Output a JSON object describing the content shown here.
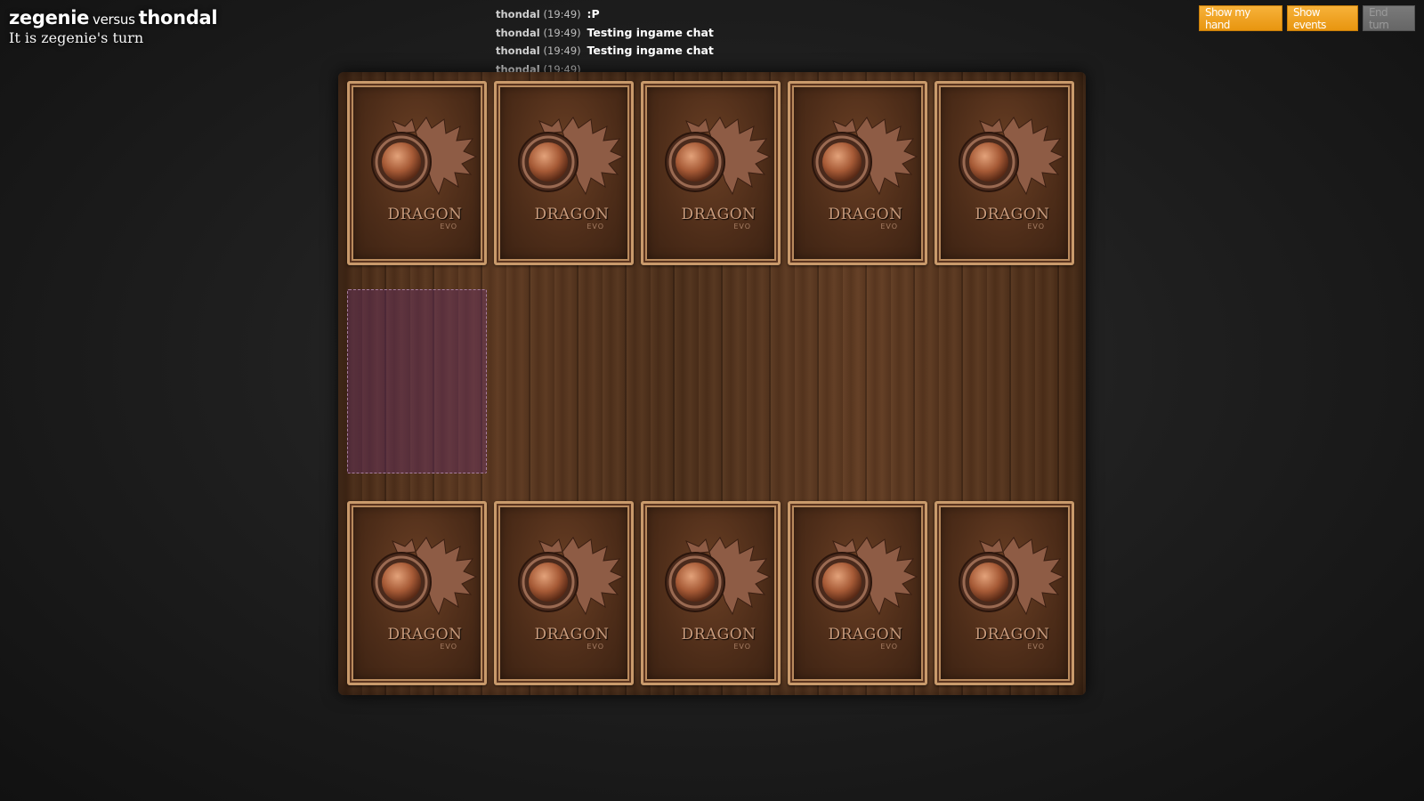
{
  "header": {
    "player1": "zegenie",
    "versus": "versus",
    "player2": "thondal",
    "turn_text": "It is zegenie's turn"
  },
  "chat": [
    {
      "user": "thondal",
      "time": "(19:49)",
      "message": ":P"
    },
    {
      "user": "thondal",
      "time": "(19:49)",
      "message": "Testing ingame chat"
    },
    {
      "user": "thondal",
      "time": "(19:49)",
      "message": "Testing ingame chat"
    },
    {
      "user": "thondal",
      "time": "(19:49)",
      "message": ""
    }
  ],
  "actions": {
    "show_hand": "Show my hand",
    "show_events": "Show events",
    "end_turn": "End turn"
  },
  "card_back": {
    "logo": "DRAGON",
    "sub": "EVO"
  },
  "board": {
    "opponent_cards": 5,
    "player_cards": 5
  },
  "colors": {
    "button": "#f0a323",
    "button_disabled": "#6e6e6e",
    "board_wood": "#4e2f1a",
    "slot_highlight": "#6e3278"
  }
}
